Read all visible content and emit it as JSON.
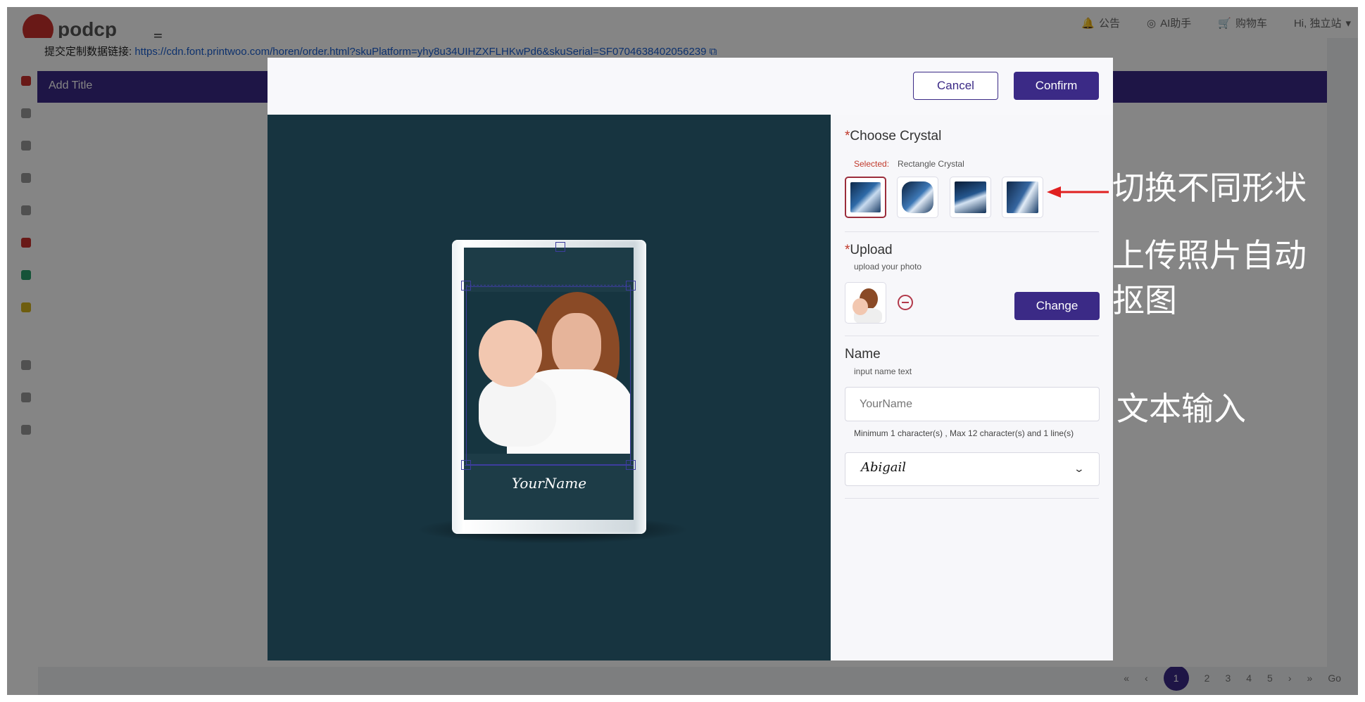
{
  "app": {
    "logo_text": "podcp",
    "nav": [
      {
        "icon": "bell-icon",
        "label": "公告"
      },
      {
        "icon": "robot-icon",
        "label": "AI助手"
      },
      {
        "icon": "cart-icon",
        "label": "购物车"
      },
      {
        "icon": "user-icon",
        "label": "Hi, 独立站"
      }
    ],
    "pagination": [
      "1",
      "2",
      "3",
      "4",
      "5"
    ],
    "goto_label": "Go"
  },
  "data_link": {
    "label": "提交定制数据链接:",
    "url": "https://cdn.font.printwoo.com/horen/order.html?skuPlatform=yhy8u34UIHZXFLHKwPd6&skuSerial=SF0704638402056239"
  },
  "mid_modal": {
    "title": "Add Title"
  },
  "dialog": {
    "cancel_label": "Cancel",
    "confirm_label": "Confirm",
    "canvas": {
      "name_text": "YourName"
    },
    "crystal": {
      "title": "Choose Crystal",
      "required_mark": "*",
      "selected_key": "Selected:",
      "selected_value": "Rectangle Crystal",
      "options": [
        {
          "name": "rectangle-crystal",
          "active": true
        },
        {
          "name": "heart-crystal",
          "active": false
        },
        {
          "name": "diamond-crystal",
          "active": false
        },
        {
          "name": "cube-crystal",
          "active": false
        }
      ]
    },
    "upload": {
      "title": "Upload",
      "required_mark": "*",
      "subtitle": "upload your photo",
      "change_label": "Change"
    },
    "name": {
      "title": "Name",
      "subtitle": "input name text",
      "placeholder": "YourName",
      "hint": "Minimum 1 character(s) , Max 12 character(s) and 1 line(s)",
      "font_value": "Abigail"
    }
  },
  "annotations": {
    "switch_shape": "切换不同形状",
    "upload_line1": "上传照片自动",
    "upload_line2": "抠图",
    "text_input": "文本输入"
  },
  "colors": {
    "brand": "#3b2a86",
    "canvas_bg": "#173440",
    "required": "#c0392b",
    "annotation_arrow": "#e02020"
  }
}
